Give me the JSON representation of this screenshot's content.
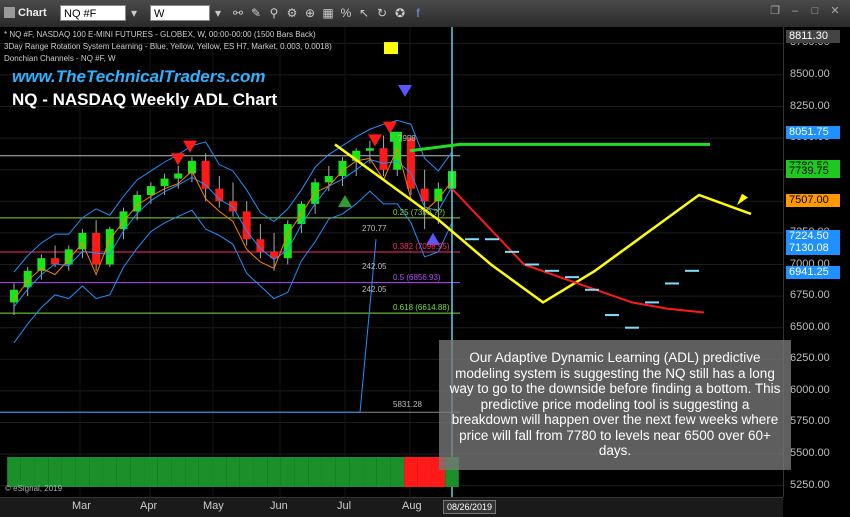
{
  "toolbar": {
    "title": "Chart",
    "symbol": "NQ #F",
    "interval": "W"
  },
  "info_lines": [
    "* NQ #F, NASDAQ 100 E-MINI FUTURES - GLOBEX, W, 00:00-00:00 (1500 Bars Back)",
    "3Day Range Rotation System Learning - Blue, Yellow, Yellow, ES H7, Market, 0.003, 0.0018)",
    "Donchian Channels - NQ #F, W"
  ],
  "brand": {
    "url": "www.TheTechnicalTraders.com",
    "title": "NQ - NASDAQ Weekly ADL Chart"
  },
  "note": "Our Adaptive Dynamic Learning (ADL) predictive modeling system is suggesting the NQ still has a long way to go to the downside before finding a bottom.  This predictive price modeling tool is suggesting a breakdown will happen over the next few weeks where price will fall from 7780 to levels near 6500 over 60+ days.",
  "copyright": "© eSignal, 2019",
  "date_tag": "08/26/2019",
  "chart_data": {
    "type": "candlestick",
    "x_labels": [
      "Mar",
      "Apr",
      "May",
      "Jun",
      "Jul",
      "Aug"
    ],
    "y_ticks": [
      "8750.00",
      "8500.00",
      "8250.00",
      "8000.00",
      "7750.00",
      "7500.00",
      "7250.00",
      "7000.00",
      "6750.00",
      "6500.00",
      "6250.00",
      "6000.00",
      "5750.00",
      "5500.00",
      "5250.00"
    ],
    "ylim": [
      5200,
      8800
    ],
    "price_tags": [
      {
        "label": "8811.30",
        "color": "#444444",
        "text": "#ffffff",
        "value": 8811.3
      },
      {
        "label": "8051.75",
        "color": "#1e90ff",
        "text": "#ffffff",
        "value": 8051.75
      },
      {
        "label": "7780.50",
        "color": "#1ec81e",
        "text": "#000000",
        "value": 7780.5
      },
      {
        "label": "7739.75",
        "color": "#1ec81e",
        "text": "#000000",
        "value": 7739.75
      },
      {
        "label": "7507.00",
        "color": "#ff9900",
        "text": "#000000",
        "value": 7507
      },
      {
        "label": "7224.50",
        "color": "#1e90ff",
        "text": "#ffffff",
        "value": 7224.5
      },
      {
        "label": "7130.08",
        "color": "#1e90ff",
        "text": "#ffffff",
        "value": 7130.08
      },
      {
        "label": "6941.25",
        "color": "#1e90ff",
        "text": "#ffffff",
        "value": 6941.25
      }
    ],
    "fib_levels": [
      {
        "ratio": "0.25",
        "label": "0.25 (7369.??)",
        "price": 7369,
        "color": "#8bd32f"
      },
      {
        "ratio": "0.382",
        "label": "0.382 (7098.95)",
        "price": 7098.95,
        "color": "#ff2a6a"
      },
      {
        "ratio": "0.5",
        "label": "0.5 (6856.93)",
        "price": 6856.93,
        "color": "#b44cff"
      },
      {
        "ratio": "0.618",
        "label": "0.618 (6614.88)",
        "price": 6614.88,
        "color": "#7ddf3a"
      }
    ],
    "annotations": [
      "7958",
      "270.77",
      "242.05",
      "242.05",
      "5831.28"
    ],
    "bars": [
      [
        6700,
        6850,
        6600,
        6800
      ],
      [
        6820,
        6980,
        6750,
        6950
      ],
      [
        6950,
        7080,
        6880,
        7050
      ],
      [
        7050,
        7150,
        6980,
        7000
      ],
      [
        7000,
        7150,
        6950,
        7120
      ],
      [
        7120,
        7280,
        7050,
        7250
      ],
      [
        7250,
        7350,
        6950,
        7000
      ],
      [
        7000,
        7300,
        6980,
        7280
      ],
      [
        7280,
        7450,
        7200,
        7420
      ],
      [
        7420,
        7580,
        7350,
        7550
      ],
      [
        7550,
        7650,
        7480,
        7620
      ],
      [
        7620,
        7720,
        7550,
        7680
      ],
      [
        7680,
        7780,
        7600,
        7720
      ],
      [
        7720,
        7850,
        7650,
        7820
      ],
      [
        7820,
        7880,
        7500,
        7600
      ],
      [
        7600,
        7700,
        7450,
        7500
      ],
      [
        7500,
        7650,
        7380,
        7420
      ],
      [
        7420,
        7500,
        7150,
        7200
      ],
      [
        7200,
        7320,
        7050,
        7100
      ],
      [
        7100,
        7250,
        6950,
        7050
      ],
      [
        7050,
        7350,
        7000,
        7320
      ],
      [
        7320,
        7500,
        7250,
        7480
      ],
      [
        7480,
        7680,
        7400,
        7650
      ],
      [
        7650,
        7780,
        7580,
        7700
      ],
      [
        7700,
        7850,
        7620,
        7820
      ],
      [
        7820,
        7920,
        7700,
        7900
      ],
      [
        7900,
        7980,
        7800,
        7920
      ],
      [
        7920,
        8020,
        7700,
        7750
      ],
      [
        7750,
        8050,
        7700,
        8000
      ],
      [
        8000,
        8020,
        7550,
        7600
      ],
      [
        7600,
        7750,
        7280,
        7500
      ],
      [
        7500,
        7650,
        7320,
        7600
      ],
      [
        7600,
        7800,
        7550,
        7739
      ]
    ],
    "projection_yellow": [
      [
        7950,
        0
      ],
      [
        7650,
        1
      ],
      [
        7350,
        2
      ],
      [
        7000,
        3
      ],
      [
        6700,
        4
      ],
      [
        6950,
        5
      ],
      [
        7250,
        6
      ],
      [
        7550,
        7
      ],
      [
        7400,
        8
      ]
    ],
    "projection_red": [
      7600,
      7300,
      7000,
      6900,
      6800,
      6700,
      6650,
      6620
    ],
    "projection_green": [
      7900,
      7950,
      7950,
      7950,
      7950,
      7950,
      7950
    ],
    "projection_dashes": [
      7200,
      7200,
      7100,
      7000,
      6950,
      6900,
      6800,
      6600,
      6500,
      6700,
      6850,
      6950
    ]
  }
}
